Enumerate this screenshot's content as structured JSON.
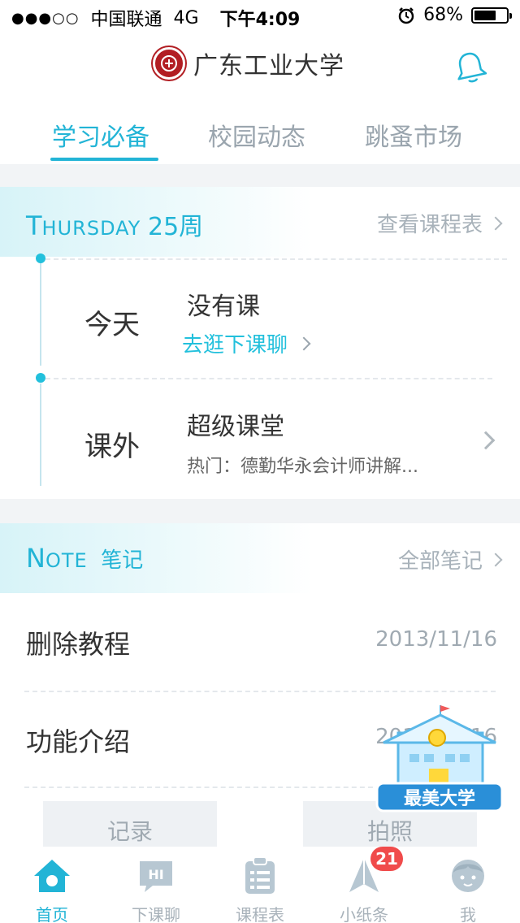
{
  "status_bar": {
    "signal": "●●●○○",
    "carrier": "中国联通",
    "network": "4G",
    "time": "下午4:09",
    "battery": "68%",
    "battery_level": 0.68
  },
  "header": {
    "school_name": "广东工业大学",
    "logo_icon": "university-seal-icon",
    "bell_icon": "bell-icon"
  },
  "tabs": [
    {
      "label": "学习必备",
      "active": true
    },
    {
      "label": "校园动态",
      "active": false
    },
    {
      "label": "跳蚤市场",
      "active": false
    }
  ],
  "schedule": {
    "day": "Thursday",
    "week": "25周",
    "link": "查看课程表",
    "rows": [
      {
        "label": "今天",
        "title": "没有课",
        "link": "去逛下课聊"
      },
      {
        "label": "课外",
        "title": "超级课堂",
        "subtitle": "热门：德勤华永会计师讲解..."
      }
    ]
  },
  "notes": {
    "title_en": "Note",
    "title_cn": "笔记",
    "link": "全部笔记",
    "items": [
      {
        "title": "删除教程",
        "date": "2013/11/16"
      },
      {
        "title": "功能介绍",
        "date": "2013/11/16"
      }
    ],
    "actions": {
      "record": "记录",
      "photo": "拍照"
    }
  },
  "mascot": {
    "text": "最美大学"
  },
  "bottom_nav": [
    {
      "label": "首页",
      "icon": "home-icon",
      "active": true
    },
    {
      "label": "下课聊",
      "icon": "chat-bubble-icon",
      "active": false
    },
    {
      "label": "课程表",
      "icon": "clipboard-icon",
      "active": false
    },
    {
      "label": "小纸条",
      "icon": "paper-plane-icon",
      "active": false,
      "badge": "21"
    },
    {
      "label": "我",
      "icon": "user-avatar-icon",
      "active": false
    }
  ],
  "colors": {
    "accent": "#22b4d6",
    "muted": "#a8b2ba",
    "badge": "#f04b4b",
    "logo": "#b21e23"
  }
}
